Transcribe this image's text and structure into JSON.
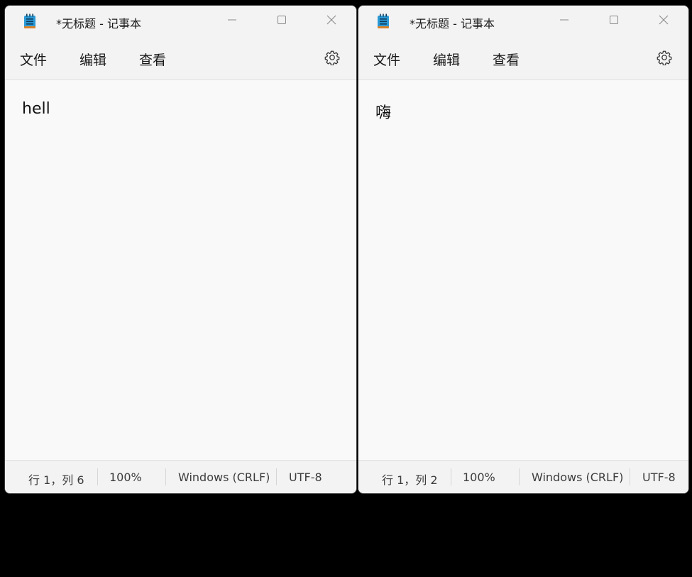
{
  "windows": [
    {
      "title": "*无标题 - 记事本",
      "menu": {
        "file": "文件",
        "edit": "编辑",
        "view": "查看"
      },
      "content": "hell",
      "status": {
        "position": "行 1，列 6",
        "zoom": "100%",
        "line_ending": "Windows (CRLF)",
        "encoding": "UTF-8"
      }
    },
    {
      "title": "*无标题 - 记事本",
      "menu": {
        "file": "文件",
        "edit": "编辑",
        "view": "查看"
      },
      "content": "嗨",
      "status": {
        "position": "行 1，列 2",
        "zoom": "100%",
        "line_ending": "Windows (CRLF)",
        "encoding": "UTF-8"
      }
    }
  ],
  "icons": {
    "app": "notepad-icon",
    "minimize": "minimize-icon",
    "maximize": "maximize-icon",
    "close": "close-icon",
    "settings": "gear-icon"
  },
  "colors": {
    "background": "#000000",
    "window": "#f9f9f9",
    "chrome": "#f3f3f3",
    "notepad_blue": "#2b9ad6"
  }
}
